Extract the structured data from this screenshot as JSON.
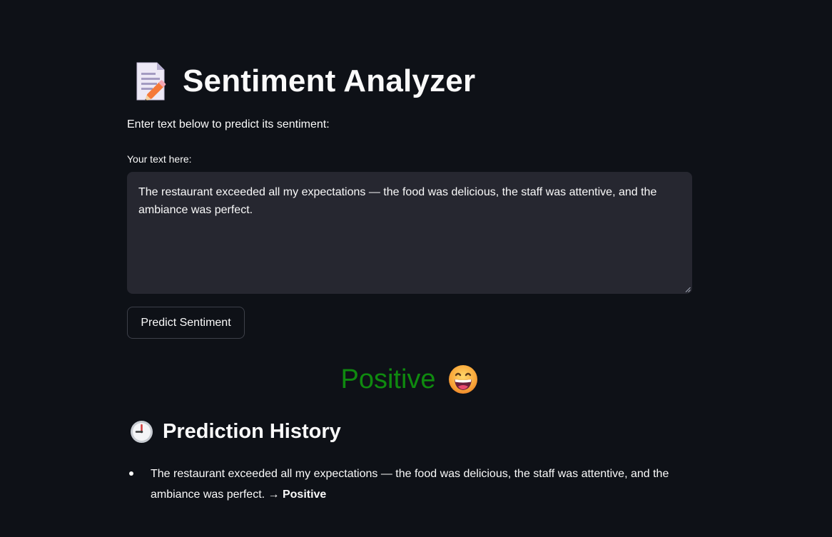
{
  "app": {
    "title": "Sentiment Analyzer",
    "title_icon": "memo-icon"
  },
  "intro": {
    "text": "Enter text below to predict its sentiment:"
  },
  "input": {
    "label": "Your text here:",
    "value": "The restaurant exceeded all my expectations — the food was delicious, the staff was attentive, and the ambiance was perfect."
  },
  "predict_button": {
    "label": "Predict Sentiment"
  },
  "result": {
    "label": "Positive",
    "emoji": "grinning-face-icon",
    "color": "#0f8a0f"
  },
  "history": {
    "heading": "Prediction History",
    "heading_icon": "clock-icon",
    "items": [
      {
        "text": "The restaurant exceeded all my expectations — the food was delicious, the staff was attentive, and the ambiance was perfect.",
        "arrow": " → ",
        "label": "Positive"
      }
    ]
  },
  "colors": {
    "background": "#0e1117",
    "input_background": "#262730",
    "text": "#fafafa",
    "positive": "#0f8a0f"
  }
}
